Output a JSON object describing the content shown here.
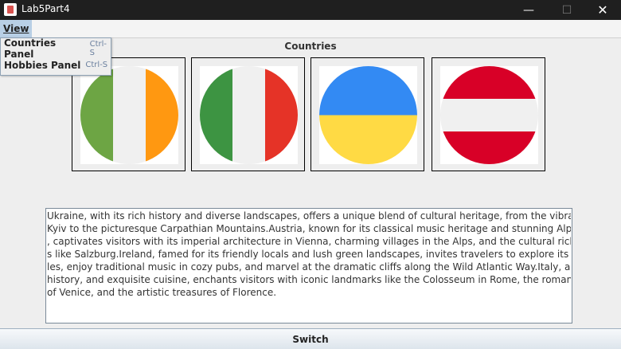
{
  "window": {
    "title": "Lab5Part4",
    "minimize_symbol": "—",
    "maximize_symbol": "☐",
    "close_symbol": "✕"
  },
  "menubar": {
    "view_label": "View"
  },
  "view_menu": {
    "items": [
      {
        "label": "Countries Panel",
        "shortcut": "Ctrl-S"
      },
      {
        "label": "Hobbies Panel",
        "shortcut": "Ctrl-S"
      }
    ]
  },
  "countries_panel": {
    "title": "Countries",
    "flags": [
      {
        "country": "Ireland",
        "icon": "ireland-flag-icon",
        "colors": [
          "#6da544",
          "#f0f0f0",
          "#ff9811"
        ]
      },
      {
        "country": "Italy",
        "icon": "italy-flag-icon",
        "colors": [
          "#3d9442",
          "#f0f0f0",
          "#e53327"
        ]
      },
      {
        "country": "Ukraine",
        "icon": "ukraine-flag-icon",
        "colors": [
          "#338af3",
          "#ffda44"
        ]
      },
      {
        "country": "Austria",
        "icon": "austria-flag-icon",
        "colors": [
          "#d80027",
          "#f0f0f0",
          "#d80027"
        ]
      }
    ]
  },
  "description": {
    "lines": [
      "Ukraine, with its rich history and diverse landscapes, offers a unique blend of cultural heritage, from the vibrant cities like",
      "Kyiv to the picturesque Carpathian Mountains.Austria, known for its classical music heritage and stunning Alpine scenery",
      ", captivates visitors with its imperial architecture in Vienna, charming villages in the Alps, and the cultural richness of citie",
      "s like Salzburg.Ireland, famed for its friendly locals and lush green landscapes, invites travelers to explore its ancient cast",
      "les, enjoy traditional music in cozy pubs, and marvel at the dramatic cliffs along the Wild Atlantic Way.Italy, a cradle of art,",
      "history, and exquisite cuisine, enchants visitors with iconic landmarks like the Colosseum in Rome, the romantic canals",
      "of Venice, and the artistic treasures of Florence."
    ]
  },
  "footer": {
    "switch_label": "Switch"
  }
}
